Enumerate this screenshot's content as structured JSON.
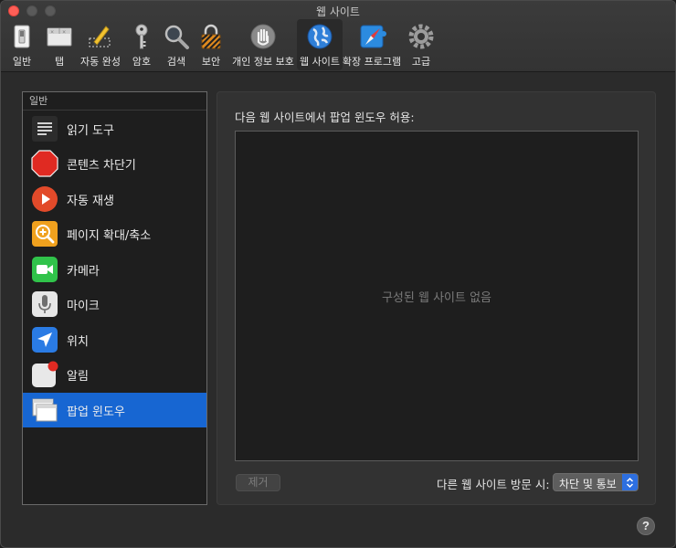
{
  "window": {
    "title": "웹 사이트"
  },
  "toolbar": {
    "tabs": [
      {
        "label": "일반",
        "icon": "general-switch-icon"
      },
      {
        "label": "탭",
        "icon": "tabs-icon"
      },
      {
        "label": "자동 완성",
        "icon": "autofill-pencil-icon"
      },
      {
        "label": "암호",
        "icon": "key-icon"
      },
      {
        "label": "검색",
        "icon": "magnifier-icon"
      },
      {
        "label": "보안",
        "icon": "padlock-icon"
      },
      {
        "label": "개인 정보 보호",
        "icon": "privacy-hand-icon"
      },
      {
        "label": "웹 사이트",
        "icon": "globe-icon",
        "selected": true
      },
      {
        "label": "확장 프로그램",
        "icon": "extensions-compass-icon"
      },
      {
        "label": "고급",
        "icon": "gear-icon"
      }
    ]
  },
  "sidebar": {
    "header": "일반",
    "items": [
      {
        "label": "읽기 도구",
        "icon": "reader-icon"
      },
      {
        "label": "콘텐츠 차단기",
        "icon": "stop-sign-icon"
      },
      {
        "label": "자동 재생",
        "icon": "play-icon"
      },
      {
        "label": "페이지 확대/축소",
        "icon": "zoom-icon"
      },
      {
        "label": "카메라",
        "icon": "camera-icon"
      },
      {
        "label": "마이크",
        "icon": "microphone-icon"
      },
      {
        "label": "위치",
        "icon": "location-arrow-icon"
      },
      {
        "label": "알림",
        "icon": "notification-icon"
      },
      {
        "label": "팝업 윈도우",
        "icon": "popup-windows-icon",
        "selected": true
      }
    ]
  },
  "main": {
    "title": "다음 웹 사이트에서 팝업 윈도우 허용:",
    "empty_text": "구성된 웹 사이트 없음",
    "remove_label": "제거",
    "other_sites_label": "다른 웹 사이트 방문 시:",
    "other_sites_value": "차단 및 통보"
  },
  "help_label": "?",
  "colors": {
    "accent": "#1766d2",
    "close": "#fe5f57"
  }
}
